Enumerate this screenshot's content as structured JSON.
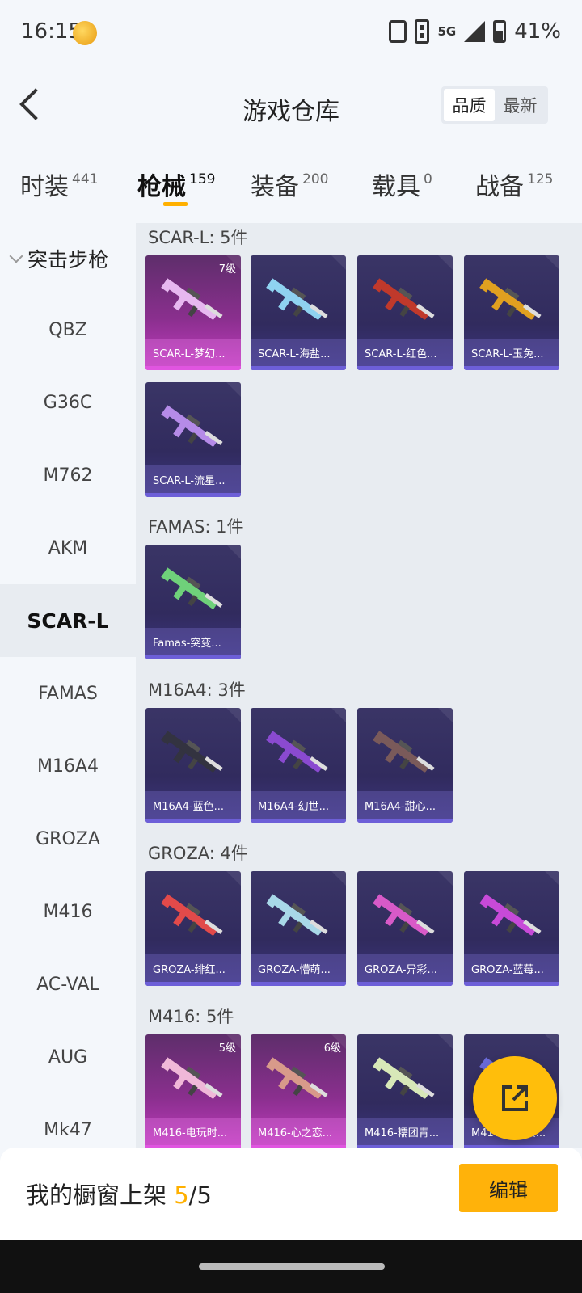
{
  "status_bar": {
    "time": "16:15",
    "network": "5G",
    "battery": "41%"
  },
  "header": {
    "title": "游戏仓库",
    "sort_options": [
      "品质",
      "最新"
    ]
  },
  "tabs": [
    {
      "label": "时装",
      "count": "441"
    },
    {
      "label": "枪械",
      "count": "159"
    },
    {
      "label": "装备",
      "count": "200"
    },
    {
      "label": "载具",
      "count": "0"
    },
    {
      "label": "战备",
      "count": "125"
    }
  ],
  "sidebar": {
    "group": "突击步枪",
    "items": [
      "QBZ",
      "G36C",
      "M762",
      "AKM",
      "SCAR-L",
      "FAMAS",
      "M16A4",
      "GROZA",
      "M416",
      "AC-VAL",
      "AUG",
      "Mk47"
    ],
    "active": "SCAR-L"
  },
  "sections": [
    {
      "title": "SCAR-L: 5件",
      "items": [
        {
          "name": "SCAR-L-梦幻...",
          "level": "7级",
          "premium": true,
          "color": "#e7b8f0"
        },
        {
          "name": "SCAR-L-海盐...",
          "level": "",
          "premium": false,
          "color": "#8fd2f0"
        },
        {
          "name": "SCAR-L-红色...",
          "level": "",
          "premium": false,
          "color": "#c0392b"
        },
        {
          "name": "SCAR-L-玉兔...",
          "level": "",
          "premium": false,
          "color": "#e0a020"
        },
        {
          "name": "SCAR-L-流星...",
          "level": "",
          "premium": false,
          "color": "#b58be8"
        }
      ]
    },
    {
      "title": "FAMAS: 1件",
      "items": [
        {
          "name": "Famas-突变...",
          "level": "",
          "premium": false,
          "color": "#6fd17a"
        }
      ]
    },
    {
      "title": "M16A4: 3件",
      "items": [
        {
          "name": "M16A4-蓝色...",
          "level": "",
          "premium": false,
          "color": "#333340"
        },
        {
          "name": "M16A4-幻世...",
          "level": "",
          "premium": false,
          "color": "#8a4ad0"
        },
        {
          "name": "M16A4-甜心...",
          "level": "",
          "premium": false,
          "color": "#7a5a5a"
        }
      ]
    },
    {
      "title": "GROZA: 4件",
      "items": [
        {
          "name": "GROZA-绯红...",
          "level": "",
          "premium": false,
          "color": "#e24a4a"
        },
        {
          "name": "GROZA-懵萌...",
          "level": "",
          "premium": false,
          "color": "#a8d8e8"
        },
        {
          "name": "GROZA-异彩...",
          "level": "",
          "premium": false,
          "color": "#d85ac8"
        },
        {
          "name": "GROZA-蓝莓...",
          "level": "",
          "premium": false,
          "color": "#c74ad8"
        }
      ]
    },
    {
      "title": "M416: 5件",
      "items": [
        {
          "name": "M416-电玩时...",
          "level": "5级",
          "premium": true,
          "color": "#f0b8d8"
        },
        {
          "name": "M416-心之恋...",
          "level": "6级",
          "premium": true,
          "color": "#d89a8a"
        },
        {
          "name": "M416-糯团青...",
          "level": "",
          "premium": false,
          "color": "#d8e8b8"
        },
        {
          "name": "M416-蓝色火...",
          "level": "",
          "premium": false,
          "color": "#6a6ad8"
        }
      ]
    }
  ],
  "bottom": {
    "showcase_label": "我的橱窗上架 ",
    "showcase_count": "5",
    "showcase_total": "/5",
    "edit_label": "编辑"
  }
}
